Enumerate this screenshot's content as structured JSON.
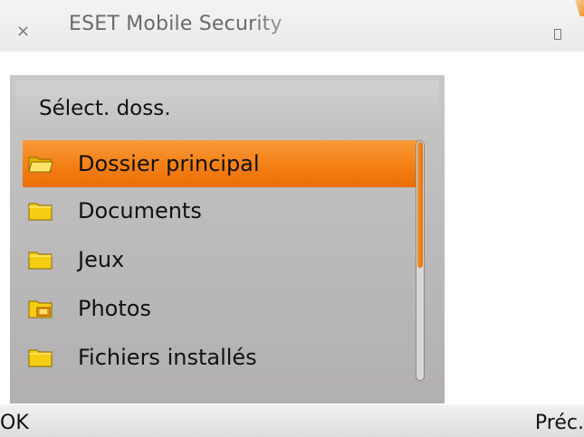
{
  "titlebar": {
    "close_glyph": "×",
    "app_title": "ESET Mobile Security"
  },
  "dialog": {
    "title": "Sélect. doss.",
    "items": [
      {
        "label": "Dossier principal",
        "icon": "folder-open-icon",
        "selected": true
      },
      {
        "label": "Documents",
        "icon": "folder-icon",
        "selected": false
      },
      {
        "label": "Jeux",
        "icon": "folder-icon",
        "selected": false
      },
      {
        "label": "Photos",
        "icon": "folder-images-icon",
        "selected": false
      },
      {
        "label": "Fichiers installés",
        "icon": "folder-icon",
        "selected": false
      }
    ],
    "scroll_fraction_visible": 0.53
  },
  "softkeys": {
    "left": "OK",
    "right": "Préc."
  },
  "colors": {
    "accent": "#f47f14",
    "folder": "#f7d21c",
    "dialog_bg": "#bebcbc"
  }
}
